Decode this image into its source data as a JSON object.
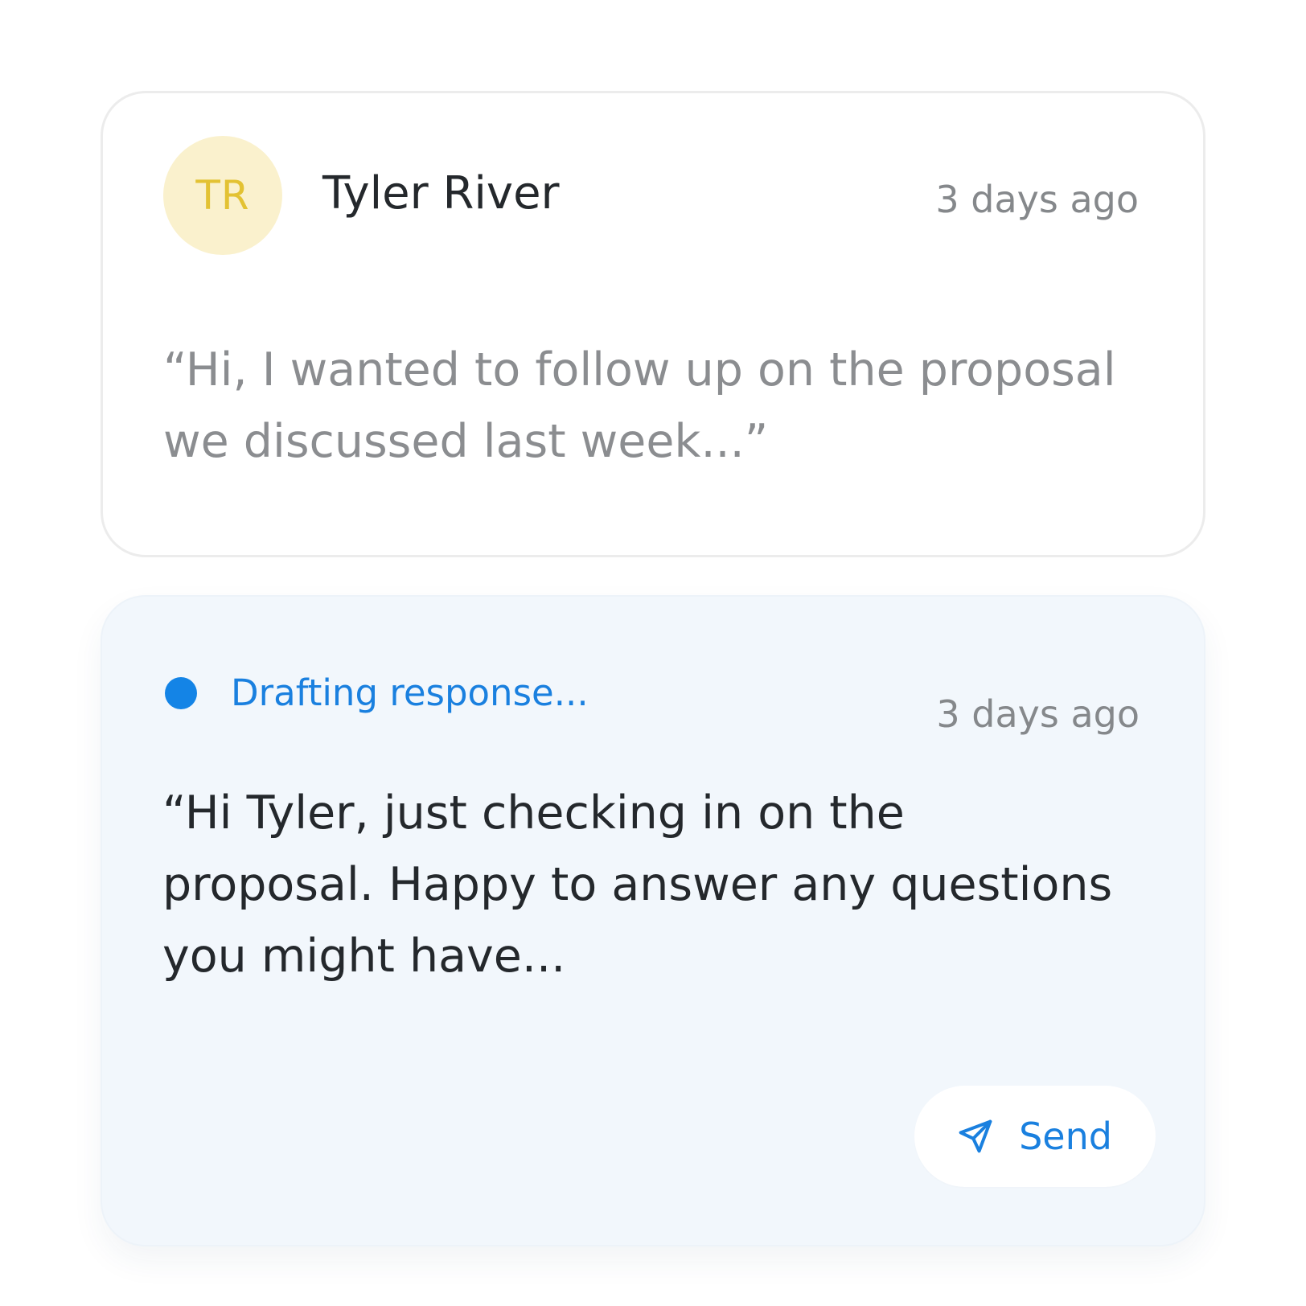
{
  "incoming": {
    "avatar_initials": "TR",
    "sender_name": "Tyler River",
    "timestamp": "3 days ago",
    "message_lines": [
      "“Hi, I wanted to follow up on the proposal",
      "we discussed last week...”"
    ]
  },
  "draft": {
    "status": "Drafting response...",
    "timestamp": "3 days ago",
    "message_lines": [
      "“Hi Tyler, just checking in on the",
      "proposal. Happy to answer any questions",
      "you might have..."
    ],
    "send_label": "Send",
    "send_icon": "send-icon"
  },
  "colors": {
    "accent": "#1a80df",
    "avatar_bg": "#faf1cd",
    "avatar_text": "#e3c233",
    "draft_bg": "#f2f7fc"
  }
}
